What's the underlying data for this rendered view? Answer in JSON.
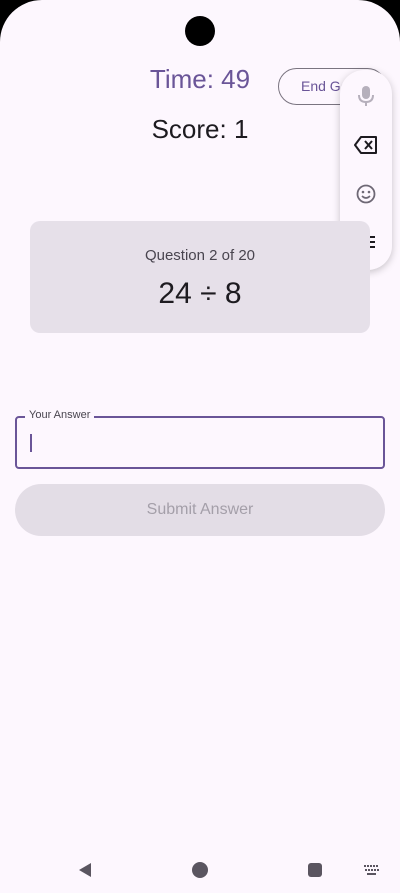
{
  "game": {
    "timer_text": "Time: 49",
    "end_game_label": "End Game",
    "score_text": "Score: 1"
  },
  "question": {
    "progress_text": "Question 2 of 20",
    "problem_text": "24 ÷ 8"
  },
  "answer": {
    "label": "Your Answer",
    "value": ""
  },
  "submit_label": "Submit Answer",
  "keyboard_toolbar": {
    "icons": [
      "microphone-icon",
      "backspace-icon",
      "emoji-icon",
      "menu-icon"
    ]
  },
  "navigation": {
    "icons": [
      "back-icon",
      "home-icon",
      "recents-icon",
      "keyboard-icon"
    ]
  },
  "colors": {
    "accent": "#6a5598",
    "background": "#fdf7fe",
    "card": "#e6e0e9",
    "disabled_button": "#e3dde6"
  }
}
